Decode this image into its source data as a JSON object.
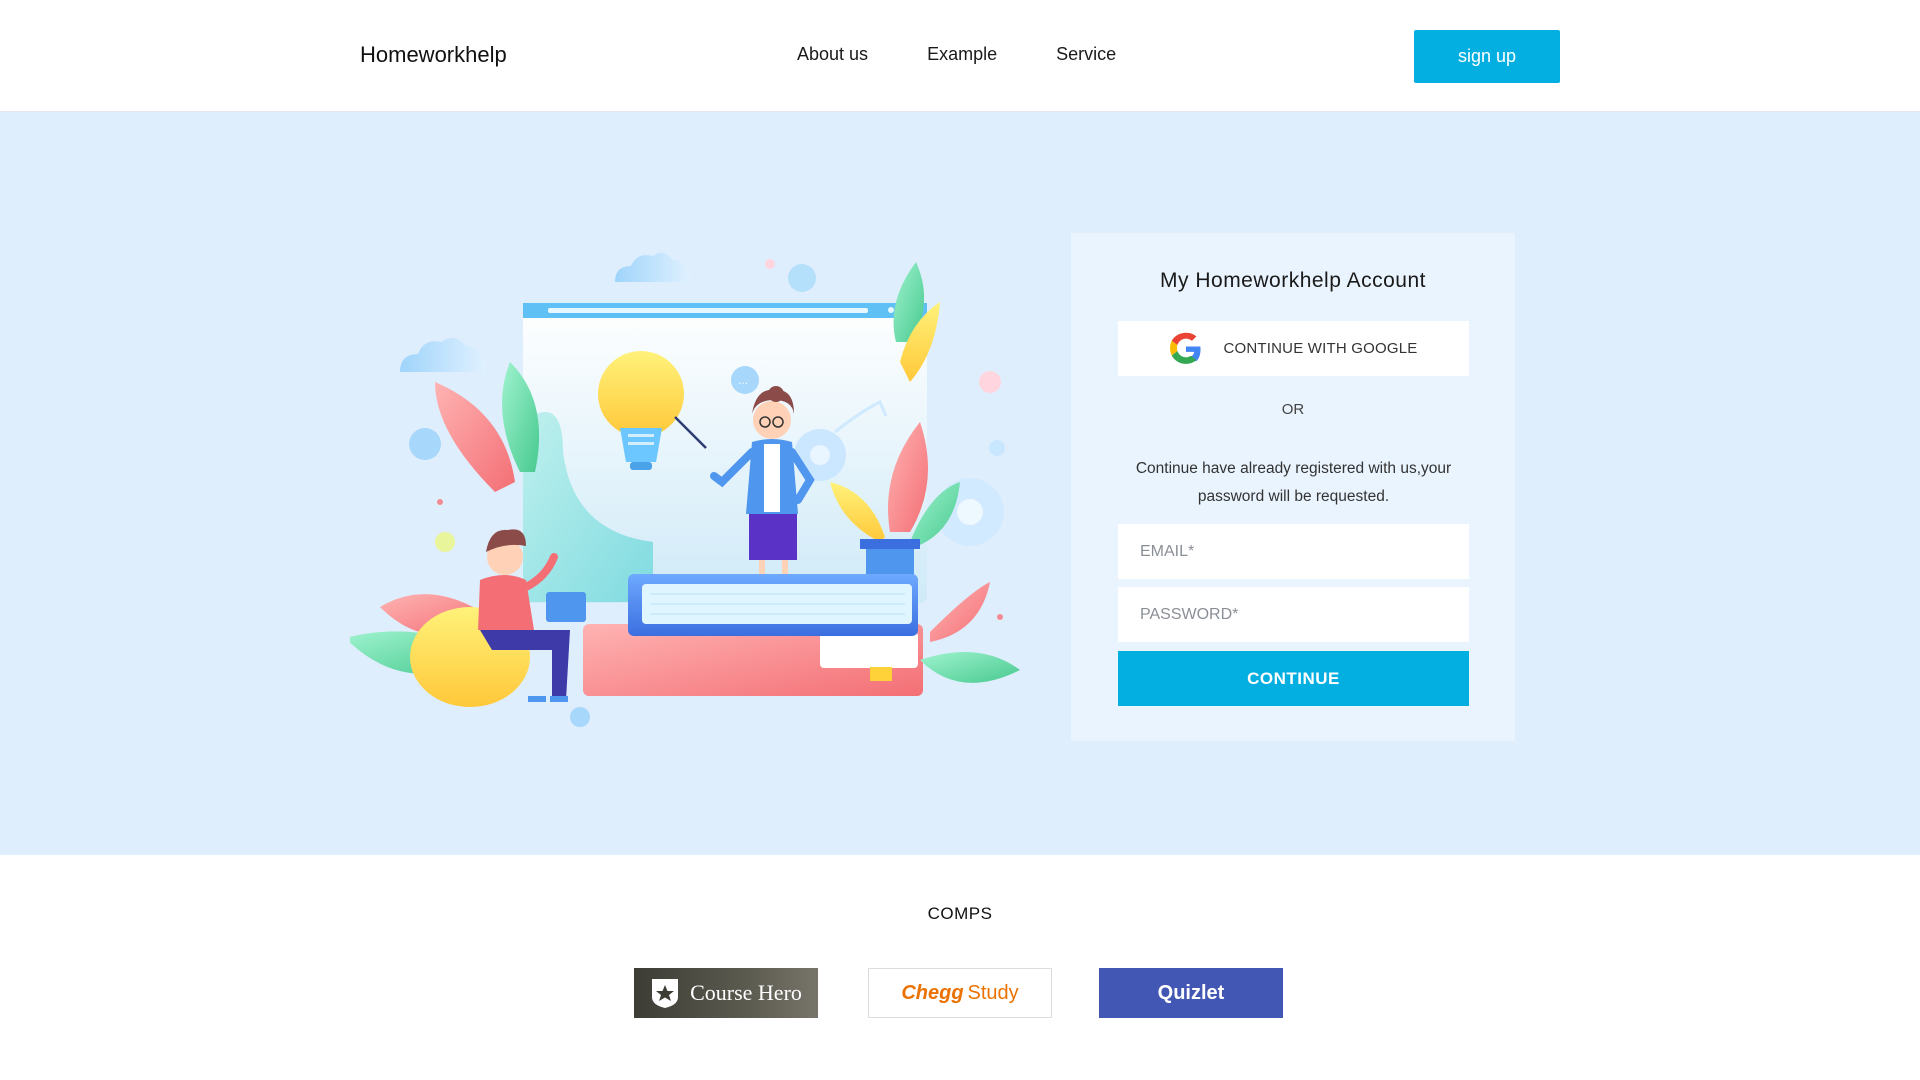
{
  "header": {
    "brand": "Homeworkhelp",
    "nav": [
      "About us",
      "Example",
      "Service"
    ],
    "signup_label": "sign up"
  },
  "login": {
    "title": "My  Homeworkhelp  Account",
    "google_label": "CONTINUE WITH GOOGLE",
    "or_label": "OR",
    "note": "Continue have already registered with us,your password will be requested.",
    "email_placeholder": "EMAIL*",
    "password_placeholder": "PASSWORD*",
    "continue_label": "CONTINUE"
  },
  "comps": {
    "title": "COMPS",
    "logos": {
      "coursehero": "Course Hero",
      "chegg": "Chegg",
      "chegg_study": "Study",
      "quizlet": "Quizlet"
    }
  },
  "colors": {
    "accent": "#03aee0",
    "hero_bg": "#dfeefd",
    "card_bg": "#eaf4fe",
    "quizlet": "#4256b4",
    "chegg": "#eb7100"
  },
  "icons": [
    "google-icon",
    "course-hero-shield-icon",
    "education-illustration"
  ]
}
